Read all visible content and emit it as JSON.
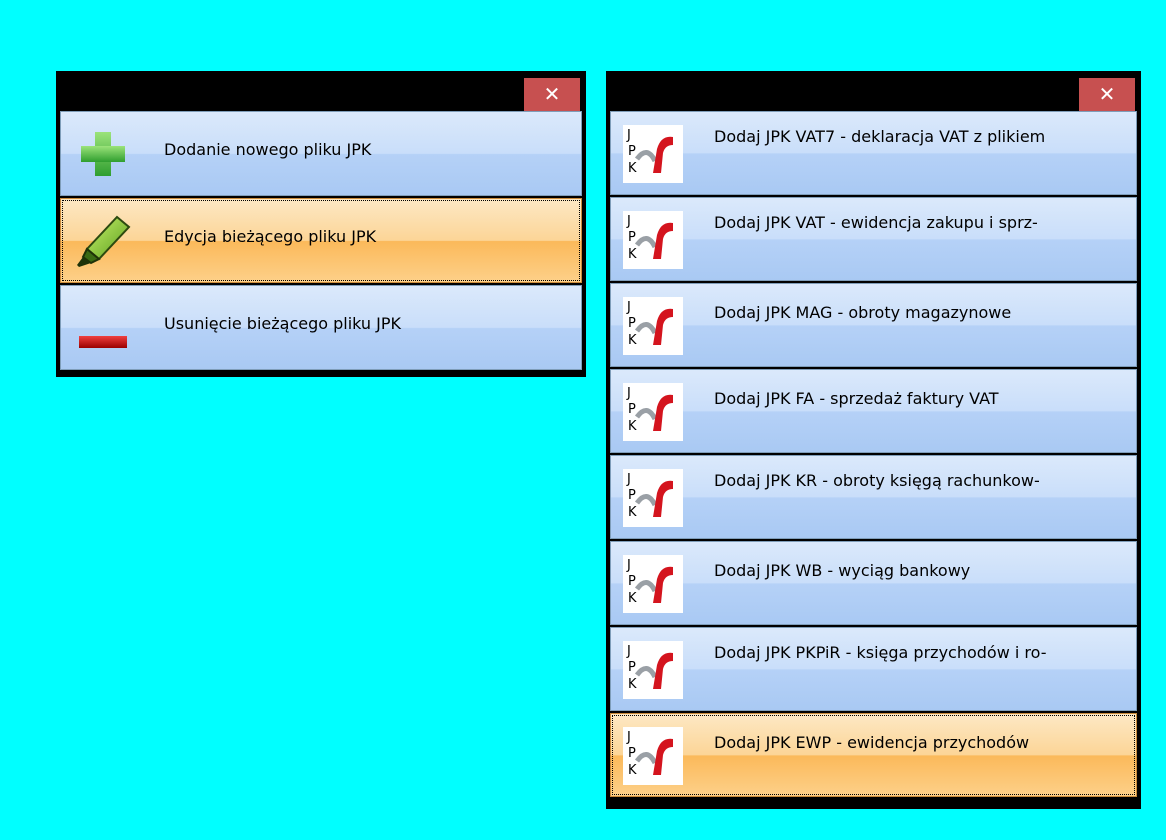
{
  "left_menu": {
    "close_glyph": "✕",
    "items": [
      {
        "label": "Dodanie nowego pliku JPK",
        "icon": "plus-icon"
      },
      {
        "label": "Edycja bieżącego pliku JPK",
        "icon": "highlighter-icon",
        "selected": true
      },
      {
        "label": "Usunięcie bieżącego pliku JPK",
        "icon": "minus-icon"
      }
    ]
  },
  "right_menu": {
    "close_glyph": "✕",
    "icon_letters": [
      "J",
      "P",
      "K"
    ],
    "items": [
      {
        "label": "Dodaj JPK VAT7 - deklaracja VAT z plikiem",
        "icon": "jpk-logo-icon"
      },
      {
        "label": "Dodaj JPK VAT - ewidencja zakupu i sprz-",
        "icon": "jpk-logo-icon"
      },
      {
        "label": "Dodaj JPK MAG - obroty magazynowe",
        "icon": "jpk-logo-icon"
      },
      {
        "label": "Dodaj JPK FA - sprzedaż faktury VAT",
        "icon": "jpk-logo-icon"
      },
      {
        "label": "Dodaj JPK KR - obroty księgą rachunkow-",
        "icon": "jpk-logo-icon"
      },
      {
        "label": "Dodaj JPK WB - wyciąg bankowy",
        "icon": "jpk-logo-icon"
      },
      {
        "label": "Dodaj JPK PKPiR - księga przychodów i ro-",
        "icon": "jpk-logo-icon"
      },
      {
        "label": "Dodaj JPK EWP - ewidencja przychodów",
        "icon": "jpk-logo-icon",
        "selected": true
      }
    ]
  },
  "colors": {
    "desktop": "#00ffff",
    "close_button": "#c75050",
    "item_gradient_top": "#dbe9fb",
    "item_gradient_bottom": "#a9c9f3",
    "selected_gradient_mid": "#fbb95a",
    "plus_green": "#3cb43c",
    "minus_red": "#c00000",
    "jpk_red": "#d4141e"
  }
}
